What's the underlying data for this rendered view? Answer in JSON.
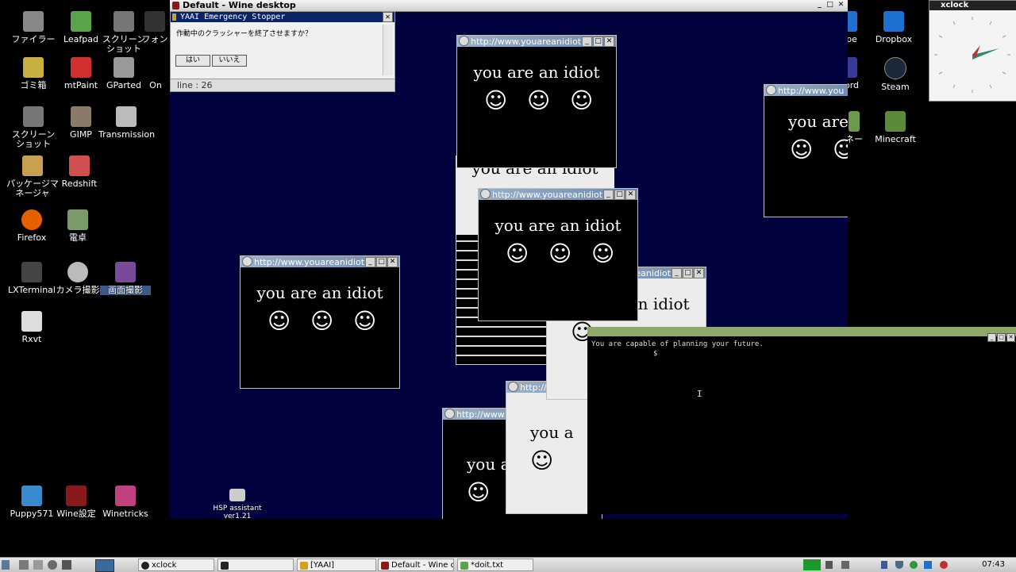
{
  "desktop_left": [
    {
      "label": "ファイラー",
      "icon": "file-manager-icon",
      "color": "#888888"
    },
    {
      "label": "Leafpad",
      "icon": "leafpad-icon",
      "color": "#5aa34a"
    },
    {
      "label": "スクリーン\nショット",
      "icon": "screenshot-icon",
      "color": "#777777"
    },
    {
      "label": "フォン",
      "icon": "font-icon",
      "color": "#333333"
    },
    {
      "label": "ゴミ箱",
      "icon": "trash-icon",
      "color": "#c8b040"
    },
    {
      "label": "mtPaint",
      "icon": "mtpaint-icon",
      "color": "#d03030"
    },
    {
      "label": "GParted",
      "icon": "gparted-icon",
      "color": "#999999"
    },
    {
      "label": "On",
      "icon": "app-icon",
      "color": "#333333"
    },
    {
      "label": "スクリーン\nショット",
      "icon": "screenshot-icon",
      "color": "#777777"
    },
    {
      "label": "GIMP",
      "icon": "gimp-icon",
      "color": "#8a7a6a"
    },
    {
      "label": "Transmission",
      "icon": "transmission-icon",
      "color": "#bbbbbb"
    },
    {
      "label": "パッケージマ\nネージャ",
      "icon": "package-manager-icon",
      "color": "#c9a050"
    },
    {
      "label": "Redshift",
      "icon": "redshift-icon",
      "color": "#d05050"
    },
    {
      "label": "Firefox",
      "icon": "firefox-icon",
      "color": "#e66000"
    },
    {
      "label": "電卓",
      "icon": "calculator-icon",
      "color": "#7a9a6a"
    },
    {
      "label": "LXTerminal",
      "icon": "terminal-icon",
      "color": "#444444"
    },
    {
      "label": "カメラ撮影",
      "icon": "camera-icon",
      "color": "#bbbbbb"
    },
    {
      "label": "画面撮影",
      "icon": "screen-record-icon",
      "color": "#7a4a9a"
    },
    {
      "label": "Rxvt",
      "icon": "rxvt-icon",
      "color": "#dddddd"
    },
    {
      "label": "Puppy571",
      "icon": "puppy-icon",
      "color": "#3a8ad0"
    },
    {
      "label": "Wine設定",
      "icon": "wine-config-icon",
      "color": "#8a1a1a"
    },
    {
      "label": "Winetricks",
      "icon": "winetricks-icon",
      "color": "#c04080"
    },
    {
      "label": "HSP assistant\nver1.21",
      "icon": "hsp-assistant-icon",
      "color": "#cccccc"
    }
  ],
  "desktop_right": [
    {
      "label": "Dropbox",
      "icon": "dropbox-icon",
      "color": "#1f6fd0"
    },
    {
      "label": "Steam",
      "icon": "steam-icon",
      "color": "#1b2838"
    },
    {
      "label": "Minecraft",
      "icon": "minecraft-icon",
      "color": "#5a8a3a"
    },
    {
      "label": "pe",
      "icon": "app-icon",
      "color": "#1f6fd0"
    },
    {
      "label": "ord",
      "icon": "app-icon",
      "color": "#3a3a9a"
    },
    {
      "label": "ネー",
      "icon": "app-icon",
      "color": "#6a9a4a"
    }
  ],
  "wine": {
    "title": "Default - Wine desktop"
  },
  "yaai": {
    "title": "YAAI Emergency Stopper",
    "question": "作動中のクラッシャーを終了させますか？",
    "yes": "はい",
    "no": "いいえ",
    "line": "line : 26"
  },
  "idiot": {
    "url": "http://www.youareanidiot.",
    "url_short": "http://www",
    "url_cut": "http://www.you",
    "message": "you are an idiot",
    "message_a": "you a",
    "smiley": "☺"
  },
  "terminal": {
    "line1": "You are capable of planning your future.",
    "prompt": "$"
  },
  "xclock": {
    "title": "xclock"
  },
  "taskbar": {
    "items": [
      "xclock",
      "",
      "[YAAI]",
      "Default - Wine d…",
      "*doit.txt"
    ],
    "time": "07:43"
  }
}
